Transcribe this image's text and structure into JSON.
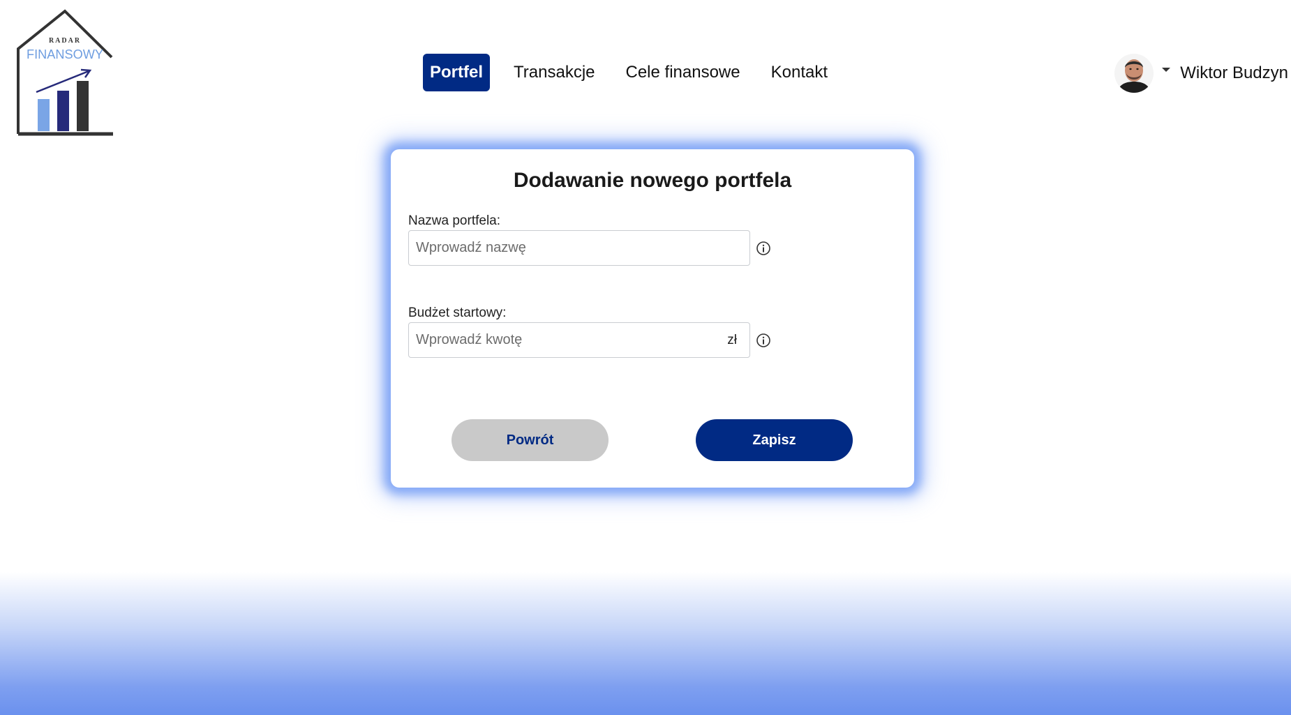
{
  "logo": {
    "top_text": "RADAR",
    "main_text": "FINANSOWY"
  },
  "nav": {
    "items": [
      {
        "label": "Portfel",
        "active": true
      },
      {
        "label": "Transakcje",
        "active": false
      },
      {
        "label": "Cele finansowe",
        "active": false
      },
      {
        "label": "Kontakt",
        "active": false
      }
    ]
  },
  "user": {
    "name": "Wiktor Budzyn"
  },
  "form": {
    "title": "Dodawanie nowego portfela",
    "name_label": "Nazwa portfela:",
    "name_placeholder": "Wprowadź nazwę",
    "budget_label": "Budżet startowy:",
    "budget_placeholder": "Wprowadź kwotę",
    "currency_suffix": "zł",
    "back_button": "Powrót",
    "save_button": "Zapisz"
  },
  "colors": {
    "primary": "#012a84",
    "secondary_button": "#c9c9c9",
    "card_glow": "#7ea0f5"
  },
  "icons": {
    "info": "info-circle-icon",
    "caret": "caret-down-icon"
  }
}
